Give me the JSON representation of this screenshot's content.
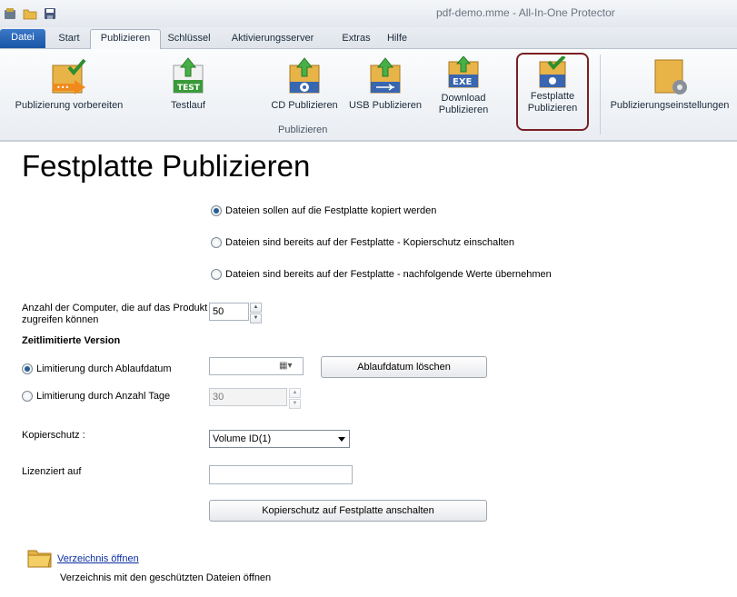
{
  "window": {
    "title": "pdf-demo.mme - All-In-One Protector"
  },
  "quick_access": [
    "app-icon",
    "open-folder-icon",
    "save-icon"
  ],
  "tabs": [
    {
      "label": "Datei"
    },
    {
      "label": "Start"
    },
    {
      "label": "Publizieren"
    },
    {
      "label": "Schlüssel"
    },
    {
      "label": "Aktivierungsserver"
    },
    {
      "label": "Extras"
    },
    {
      "label": "Hilfe"
    }
  ],
  "ribbon": {
    "buttons": [
      {
        "label": "Publizierung vorbereiten"
      },
      {
        "label": "Testlauf"
      },
      {
        "label": "CD Publizieren"
      },
      {
        "label": "USB Publizieren"
      },
      {
        "label": "Download Publizieren",
        "icon_text": "EXE"
      },
      {
        "label": "Festplatte Publizieren"
      },
      {
        "label": "Publizierungseinstellungen"
      }
    ],
    "test_icon_text": "TEST",
    "group_label": "Publizieren"
  },
  "page": {
    "title": "Festplatte Publizieren",
    "options": [
      {
        "label": "Dateien sollen auf die Festplatte kopiert werden",
        "checked": true
      },
      {
        "label": "Dateien sind bereits auf der Festplatte - Kopierschutz einschalten",
        "checked": false
      },
      {
        "label": "Dateien sind bereits auf der Festplatte - nachfolgende Werte übernehmen",
        "checked": false
      }
    ],
    "computers_label_line1": "Anzahl der Computer, die auf das Produkt",
    "computers_label_line2": "zugreifen können",
    "computers_value": "50",
    "time_limited_heading": "Zeitlimitierte Version",
    "limit_by_date_label": "Limitierung durch Ablaufdatum",
    "limit_by_date_checked": true,
    "date_value": "",
    "clear_date_button": "Ablaufdatum löschen",
    "limit_by_days_label": "Limitierung durch Anzahl Tage",
    "limit_by_days_checked": false,
    "days_value": "30",
    "copy_protection_label": "Kopierschutz :",
    "copy_protection_value": "Volume ID(1)",
    "licensed_to_label": "Lizenziert auf",
    "licensed_to_value": "",
    "enable_button": "Kopierschutz auf Festplatte anschalten",
    "open_dir_link": "Verzeichnis öffnen",
    "open_dir_desc": "Verzeichnis mit den geschützten Dateien öffnen"
  }
}
